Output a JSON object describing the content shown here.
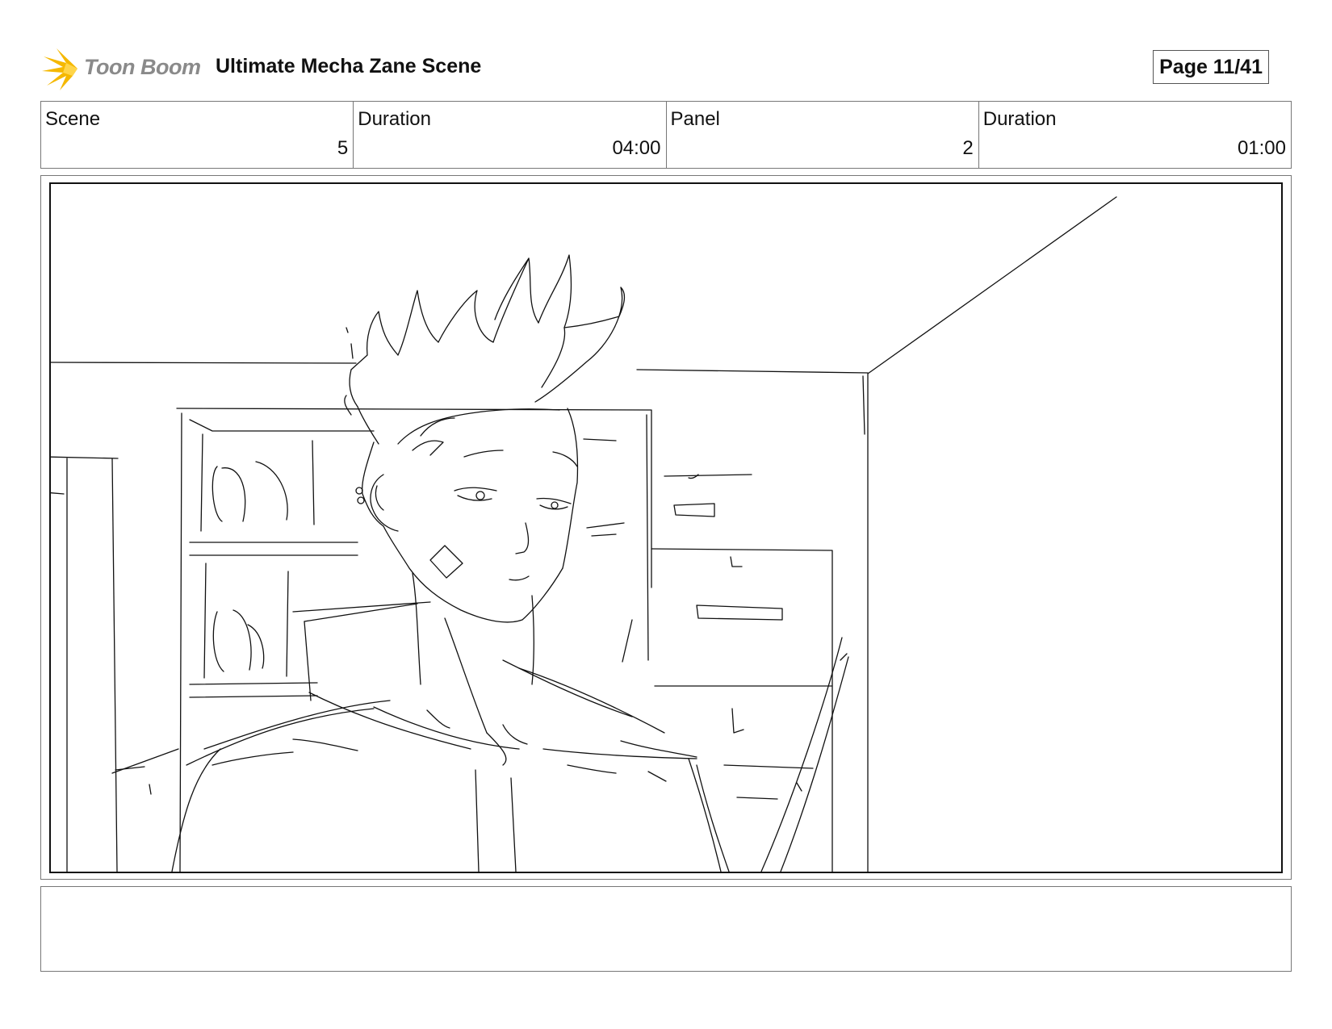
{
  "header": {
    "logo_text": "Toon Boom",
    "title": "Ultimate Mecha Zane Scene",
    "page": "Page 11/41"
  },
  "info": {
    "scene_label": "Scene",
    "scene_value": "5",
    "scene_duration_label": "Duration",
    "scene_duration_value": "04:00",
    "panel_label": "Panel",
    "panel_value": "2",
    "panel_duration_label": "Duration",
    "panel_duration_value": "01:00"
  },
  "notes": {
    "text": ""
  },
  "colors": {
    "logo_star": "#f5b800",
    "logo_text": "#8a8a8a",
    "border": "#777777",
    "ink": "#111111"
  },
  "icons": {
    "logo": "toon-boom-star-icon"
  }
}
